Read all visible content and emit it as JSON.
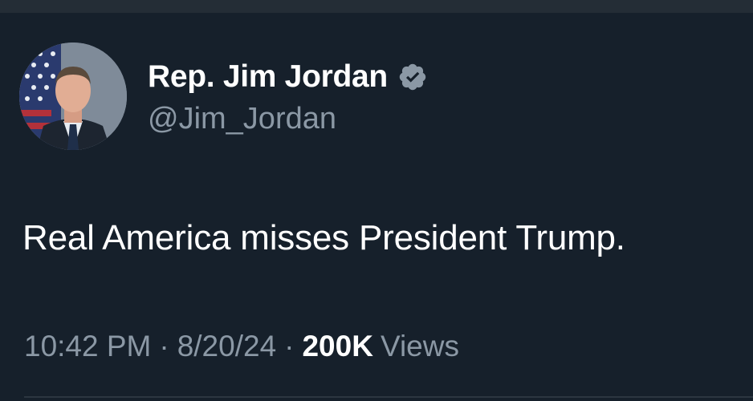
{
  "tweet": {
    "author": {
      "display_name": "Rep. Jim Jordan",
      "handle": "@Jim_Jordan",
      "verified_icon": "verified-badge-icon",
      "verified_color": "#8b98a5"
    },
    "text": "Real America misses President Trump.",
    "meta": {
      "time": "10:42 PM",
      "separator": "·",
      "date": "8/20/24",
      "views_count": "200K",
      "views_label": "Views"
    }
  },
  "colors": {
    "background": "#16202b",
    "primary_text": "#ffffff",
    "secondary_text": "#8b98a5"
  }
}
